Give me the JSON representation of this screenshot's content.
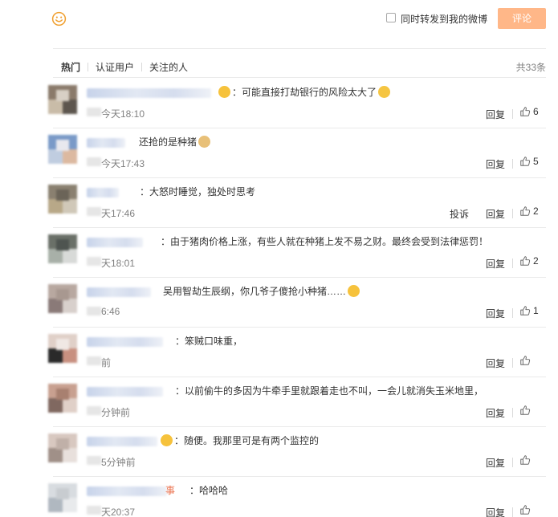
{
  "composer": {
    "emoji_icon": "smiley-face-icon",
    "repost_label": "同时转发到我的微博",
    "submit_label": "评论",
    "submit_color": "#ffb788"
  },
  "tabs": [
    {
      "label": "热门",
      "active": true
    },
    {
      "label": "认证用户",
      "active": false
    },
    {
      "label": "关注的人",
      "active": false
    }
  ],
  "total": "共33条",
  "comments": [
    {
      "name_visible": "",
      "emoji_before": "heart-eyes-emoji-icon",
      "text": "：可能直接打劫银行的风险太大了",
      "emoji_after": "laugh-cry-emoji-icon",
      "time": "今天18:10",
      "report": "",
      "reply": "回复",
      "likes": "6"
    },
    {
      "name_visible": "",
      "emoji_before": "",
      "text": "还抢的是种猪",
      "emoji_after": "doge-emoji-icon",
      "time": "今天17:43",
      "report": "",
      "reply": "回复",
      "likes": "5"
    },
    {
      "name_visible": "",
      "emoji_before": "",
      "text": "：大怒时睡觉，独处时思考",
      "emoji_after": "",
      "time": "天17:46",
      "report": "投诉",
      "reply": "回复",
      "likes": "2"
    },
    {
      "name_visible": "",
      "emoji_before": "",
      "text": "：由于猪肉价格上涨，有些人就在种猪上发不易之财。最终会受到法律惩罚！",
      "emoji_after": "",
      "time": "天18:01",
      "report": "",
      "reply": "回复",
      "likes": "2"
    },
    {
      "name_visible": "",
      "emoji_before": "",
      "text": "吴用智劫生辰纲，你几爷子傻抢小种猪……",
      "emoji_after": "blush-emoji-icon",
      "time": "6:46",
      "report": "",
      "reply": "回复",
      "likes": "1"
    },
    {
      "name_visible": "",
      "emoji_before": "",
      "text": "：笨贼口味重，",
      "emoji_after": "",
      "time": "前",
      "report": "",
      "reply": "回复",
      "likes": ""
    },
    {
      "name_visible": "",
      "emoji_before": "",
      "text": "：以前偷牛的多因为牛牵手里就跟着走也不叫，一会儿就消失玉米地里，",
      "emoji_after": "",
      "time": "分钟前",
      "report": "",
      "reply": "回复",
      "likes": ""
    },
    {
      "name_visible": "",
      "emoji_before": "heart-eyes-emoji-icon",
      "text": "：随便。我那里可是有两个监控的",
      "emoji_after": "",
      "time": "5分钟前",
      "report": "",
      "reply": "回复",
      "likes": ""
    },
    {
      "name_visible": "事",
      "emoji_before": "",
      "text": "：哈哈哈",
      "emoji_after": "",
      "time": "天20:37",
      "report": "",
      "reply": "回复",
      "likes": ""
    }
  ]
}
